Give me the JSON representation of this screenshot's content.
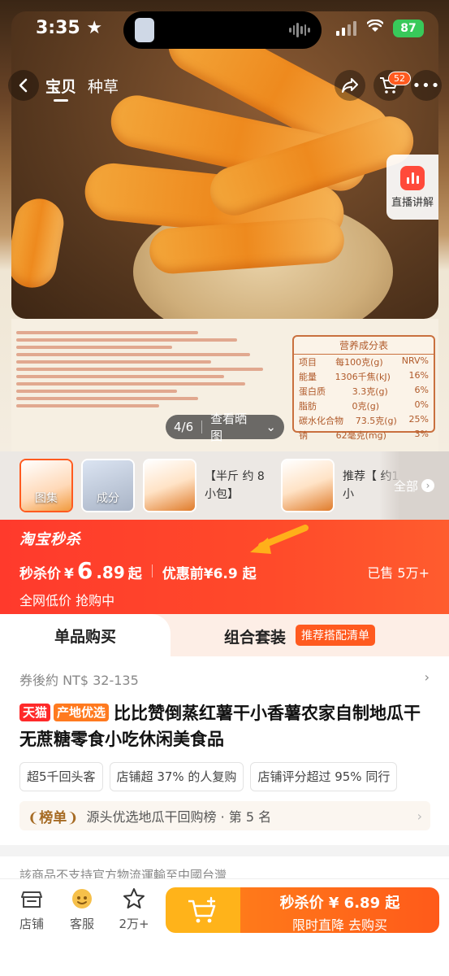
{
  "status_bar": {
    "time": "3:35",
    "battery": "87"
  },
  "nav": {
    "tab_product": "宝贝",
    "tab_seed": "种草",
    "cart_count": "52"
  },
  "live": {
    "label": "直播讲解"
  },
  "gallery": {
    "counter": "4/6",
    "view_photos": "查看晒图"
  },
  "nutrition": {
    "title": "营养成分表",
    "header": [
      "项目",
      "每100克(g)",
      "NRV%"
    ],
    "rows": [
      [
        "能量",
        "1306千焦(kJ)",
        "16%"
      ],
      [
        "蛋白质",
        "3.3克(g)",
        "6%"
      ],
      [
        "脂肪",
        "0克(g)",
        "0%"
      ],
      [
        "碳水化合物",
        "73.5克(g)",
        "25%"
      ],
      [
        "钠",
        "62毫克(mg)",
        "3%"
      ]
    ]
  },
  "thumbs": {
    "t1_caption": "图集",
    "t2_caption": "成分",
    "t3_text": "【半斤 约 8小包】",
    "t4_text": "推荐【 约16小",
    "all": "全部"
  },
  "flash": {
    "logo": "淘宝秒杀",
    "price_label": "秒杀价",
    "currency": "¥",
    "price_big": "6",
    "price_small": ".89",
    "price_suffix": "起",
    "before_label": "优惠前¥6.9 起",
    "sold": "已售 5万+",
    "sub": "全网低价 抢购中"
  },
  "buy_tabs": {
    "single": "单品购买",
    "combo": "组合套装",
    "combo_tag": "推荐搭配清单"
  },
  "product": {
    "coupon": "券後約 NT$ 32-135",
    "tag_tmall": "天猫",
    "tag_origin": "产地优选",
    "title": "比比赞倒蒸红薯干小香薯农家自制地瓜干无蔗糖零食小吃休闲美食品",
    "chips": [
      "超5千回头客",
      "店铺超 37% 的人复购",
      "店铺评分超过 95% 同行"
    ],
    "rank_badge": "榜单",
    "rank_text": "源头优选地瓜干回购榜 · 第 5 名",
    "ship_note": "該商品不支持官方物流運輸至中國台灣"
  },
  "bottom": {
    "store": "店铺",
    "service": "客服",
    "fav": "2万+",
    "buy_main": "秒杀价 ¥ 6.89 起",
    "buy_sub": "限时直降  去购买"
  }
}
